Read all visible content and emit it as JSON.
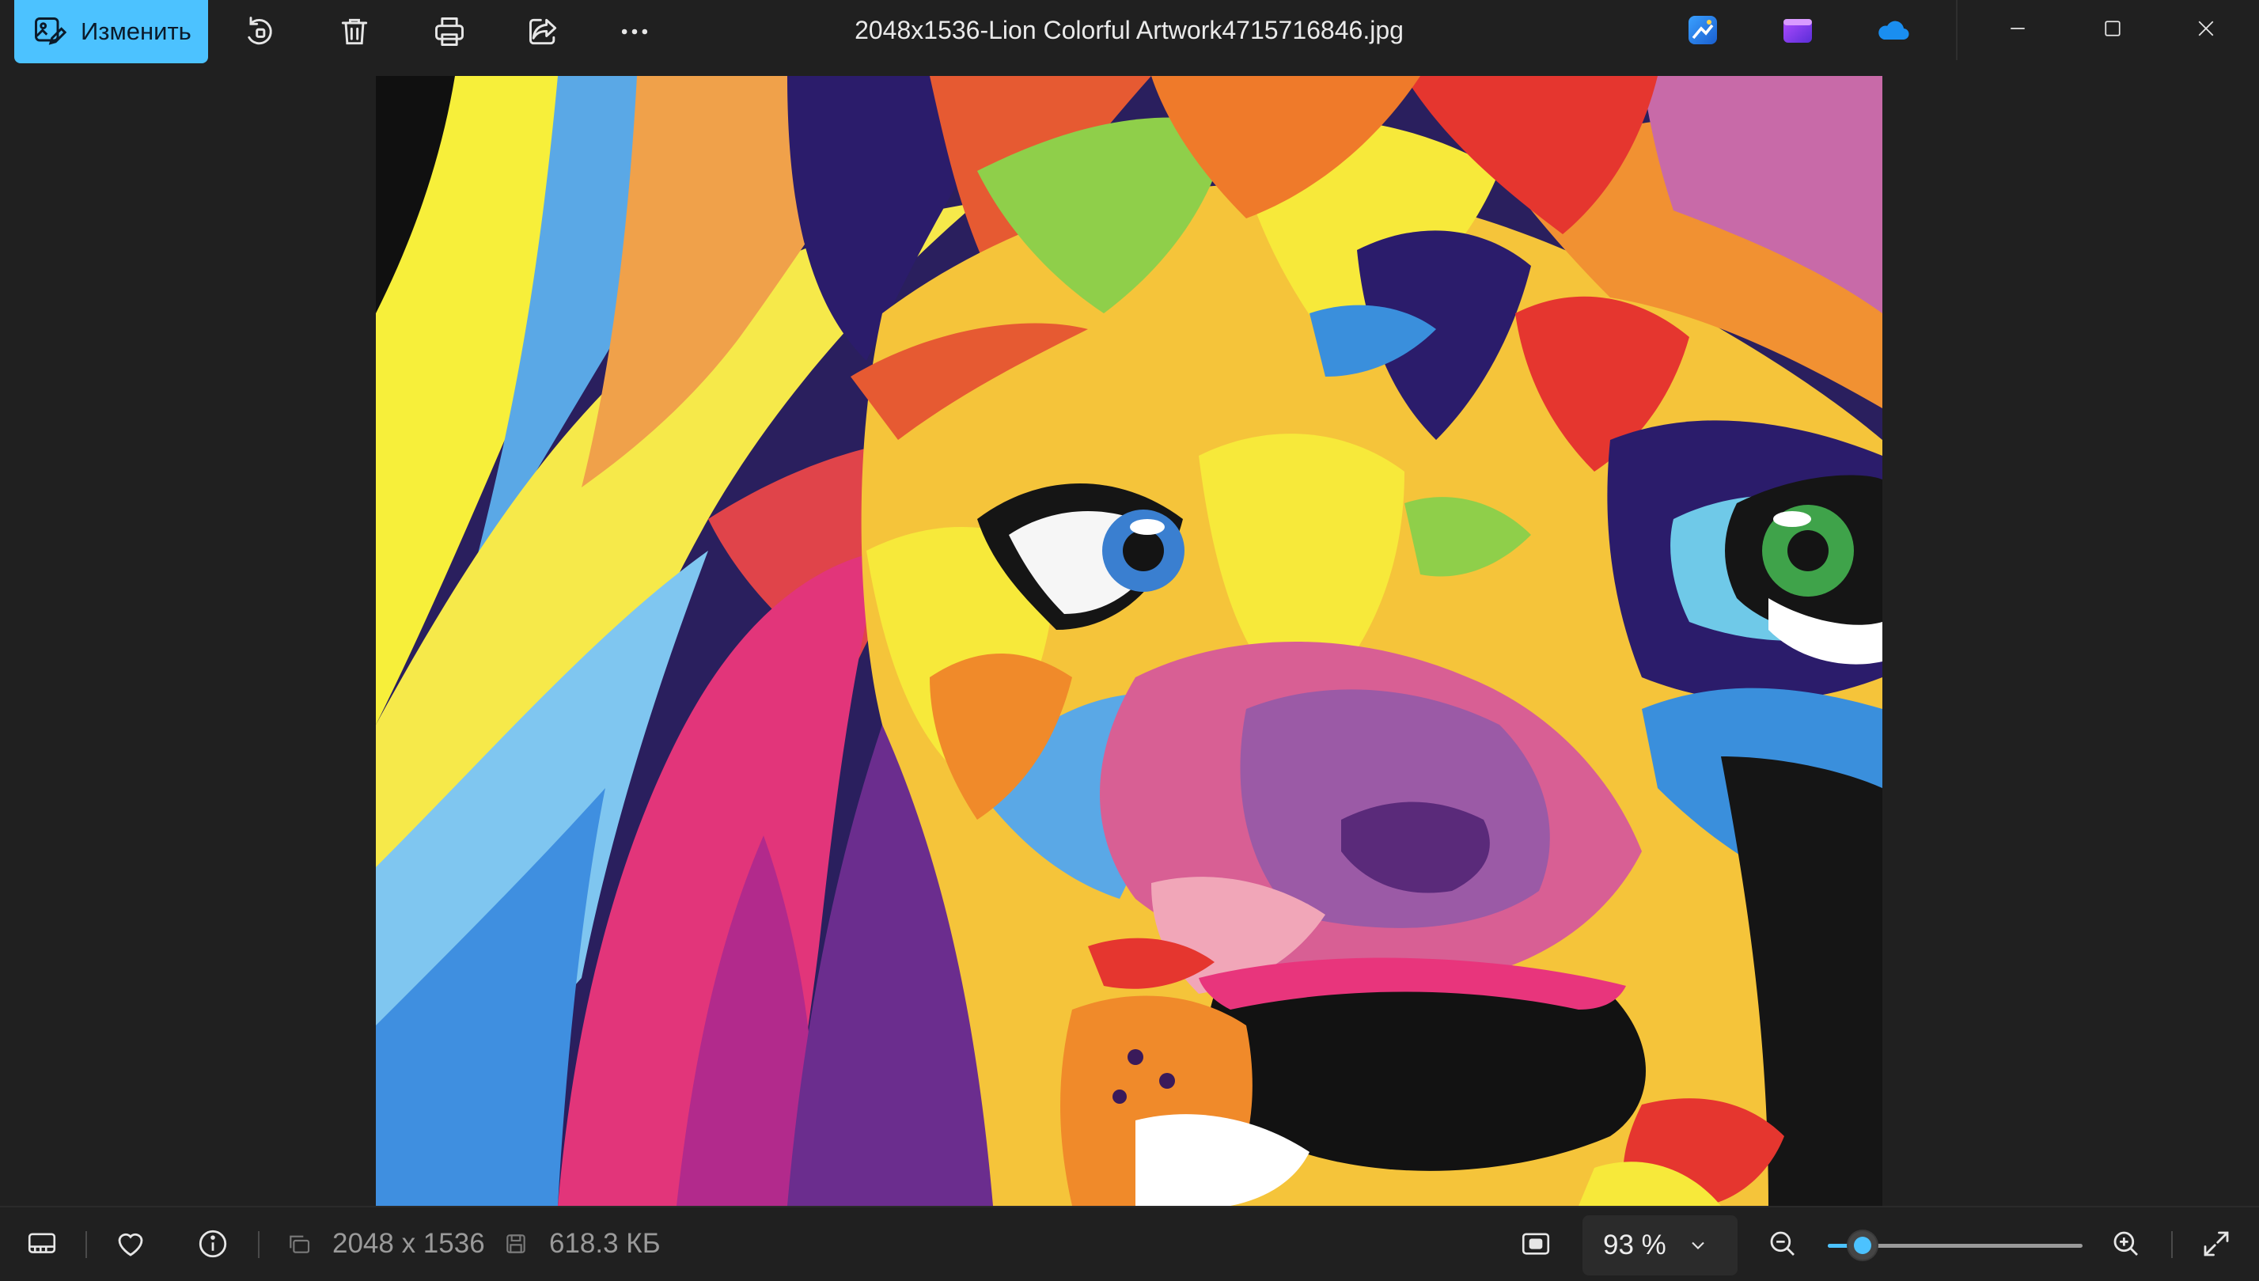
{
  "toolbar": {
    "edit_label": "Изменить",
    "file_title": "2048x1536-Lion Colorful Artwork4715716846.jpg",
    "icons": [
      "edit-image-icon",
      "rotate-icon",
      "delete-icon",
      "print-icon",
      "share-icon",
      "more-icon"
    ],
    "apps": [
      "photo-editor-app-icon",
      "clipchamp-app-icon",
      "onedrive-app-icon"
    ]
  },
  "window_controls": [
    "minimize",
    "maximize",
    "close"
  ],
  "image": {
    "subject": "Lion Colorful Artwork"
  },
  "status": {
    "dimensions": "2048 x 1536",
    "file_size": "618.3 КБ",
    "zoom_label": "93 %",
    "zoom_fraction": 0.09
  },
  "colors": {
    "accent": "#4cc2ff",
    "background": "#202020"
  }
}
